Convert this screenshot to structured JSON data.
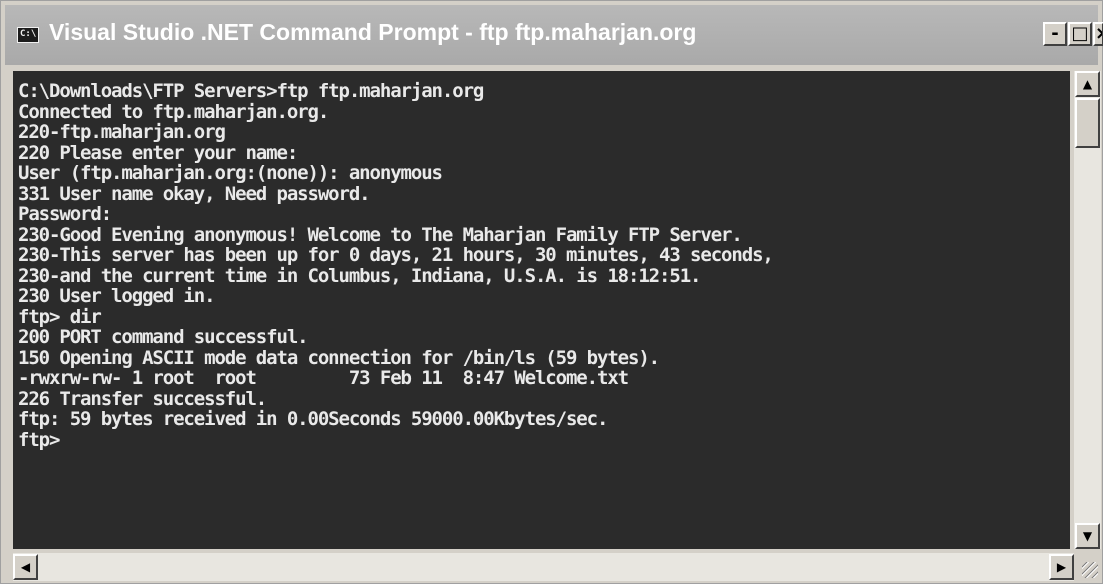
{
  "window": {
    "title": "Visual Studio .NET Command Prompt - ftp ftp.maharjan.org",
    "icon": "console-icon",
    "icon_text": "C:\\",
    "controls": {
      "minimize": "-",
      "maximize": "□",
      "close": "×"
    }
  },
  "console": {
    "lines": [
      "C:\\Downloads\\FTP Servers>ftp ftp.maharjan.org",
      "Connected to ftp.maharjan.org.",
      "220-ftp.maharjan.org",
      "220 Please enter your name:",
      "User (ftp.maharjan.org:(none)): anonymous",
      "331 User name okay, Need password.",
      "Password:",
      "230-Good Evening anonymous! Welcome to The Maharjan Family FTP Server.",
      "230-This server has been up for 0 days, 21 hours, 30 minutes, 43 seconds,",
      "230-and the current time in Columbus, Indiana, U.S.A. is 18:12:51.",
      "230 User logged in.",
      "ftp> dir",
      "200 PORT command successful.",
      "150 Opening ASCII mode data connection for /bin/ls (59 bytes).",
      "-rwxrw-rw- 1 root  root         73 Feb 11  8:47 Welcome.txt",
      "226 Transfer successful.",
      "ftp: 59 bytes received in 0.00Seconds 59000.00Kbytes/sec.",
      "ftp>"
    ]
  },
  "scrollbars": {
    "up_arrow": "▲",
    "down_arrow": "▼",
    "left_arrow": "◀",
    "right_arrow": "▶"
  },
  "colors": {
    "console_background": "#2b2b2b",
    "console_text": "#e9e9e9",
    "titlebar": "#a9a9a9",
    "chrome": "#d4d0c8"
  }
}
